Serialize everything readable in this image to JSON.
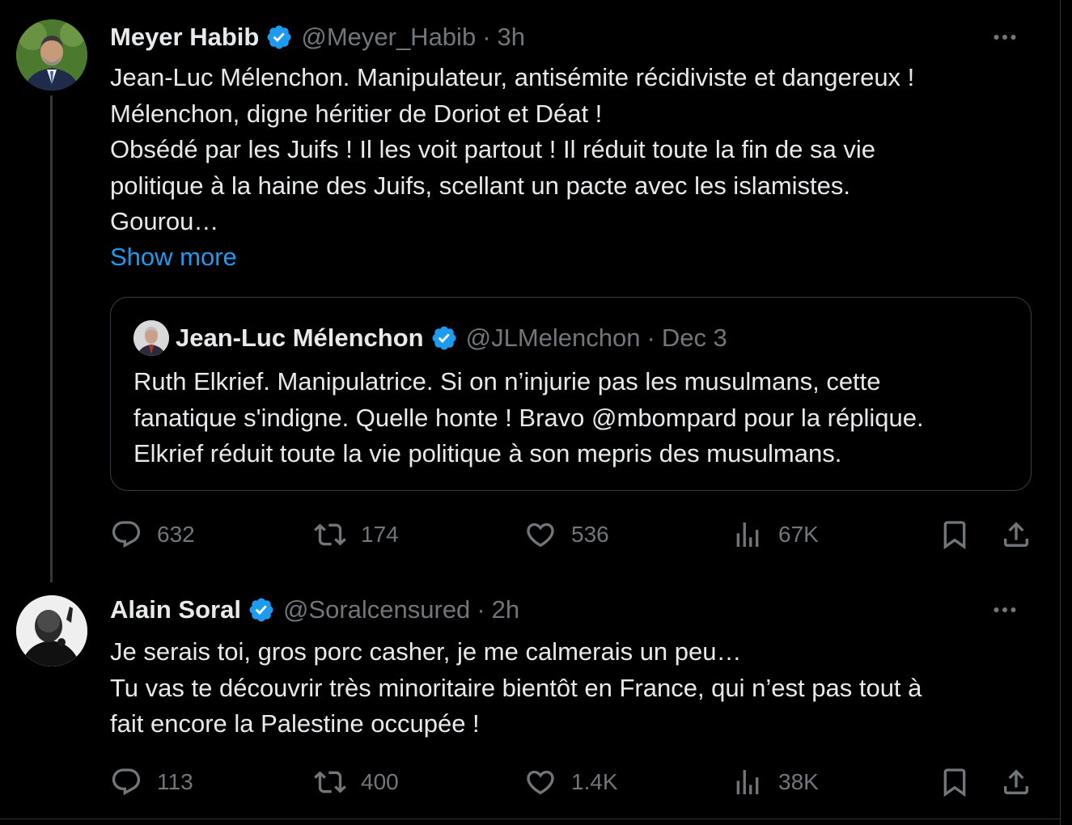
{
  "tweets": [
    {
      "author": {
        "name": "Meyer Habib",
        "handle": "@Meyer_Habib",
        "time": "3h",
        "verified": true
      },
      "text_lines": [
        "Jean-Luc Mélenchon. Manipulateur, antisémite récidiviste et dangereux !",
        "Mélenchon, digne héritier de Doriot et Déat !",
        "Obsédé par les Juifs ! Il les voit partout ! Il réduit toute la fin de sa vie",
        "politique à la haine des Juifs, scellant un pacte avec les islamistes.",
        "Gourou…"
      ],
      "show_more": "Show more",
      "quote": {
        "author": {
          "name": "Jean-Luc Mélenchon",
          "handle": "@JLMelenchon",
          "time": "Dec 3",
          "verified": true
        },
        "text_lines": [
          "Ruth Elkrief. Manipulatrice. Si on n’injurie pas les musulmans, cette",
          "fanatique s'indigne. Quelle honte ! Bravo @mbompard pour la réplique.",
          "Elkrief réduit toute la vie politique à son mepris des musulmans."
        ]
      },
      "stats": {
        "replies": "632",
        "reposts": "174",
        "likes": "536",
        "views": "67K"
      }
    },
    {
      "author": {
        "name": "Alain Soral",
        "handle": "@Soralcensured",
        "time": "2h",
        "verified": true
      },
      "text_lines": [
        "Je serais toi, gros porc casher, je me calmerais un peu…",
        "Tu vas te découvrir très minoritaire bientôt en France, qui n’est pas tout à",
        "fait encore la Palestine occupée !"
      ],
      "stats": {
        "replies": "113",
        "reposts": "400",
        "likes": "1.4K",
        "views": "38K"
      }
    }
  ],
  "separator": "·",
  "colors": {
    "background": "#000000",
    "text": "#e7e9ea",
    "secondary": "#71767b",
    "link": "#1d9bf0",
    "verified": "#1d9bf0",
    "border": "#2f3336"
  },
  "icons": [
    "verified-badge-icon",
    "more-icon",
    "reply-icon",
    "repost-icon",
    "like-icon",
    "views-icon",
    "bookmark-icon",
    "share-icon"
  ]
}
